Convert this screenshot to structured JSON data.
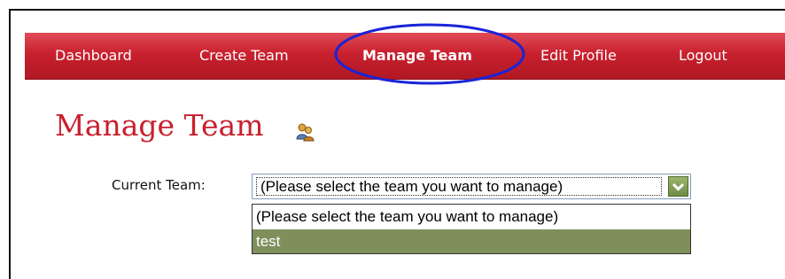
{
  "nav": {
    "items": [
      {
        "label": "Dashboard"
      },
      {
        "label": "Create Team"
      },
      {
        "label": "Manage Team",
        "active": true
      },
      {
        "label": "Edit Profile"
      },
      {
        "label": "Logout"
      }
    ],
    "highlight_color": "#1a24d6",
    "bar_color": "#c9202e"
  },
  "page": {
    "title": "Manage Team",
    "title_icon": "team-users-icon",
    "title_color": "#c8202e"
  },
  "form": {
    "current_team_label": "Current Team:",
    "select_value": "(Please select the team you want to manage)",
    "arrow_icon": "chevron-down-icon",
    "options": [
      "(Please select the team you want to manage)",
      "test"
    ],
    "highlighted_option": "test",
    "highlight_bg": "#7f8f5c"
  }
}
